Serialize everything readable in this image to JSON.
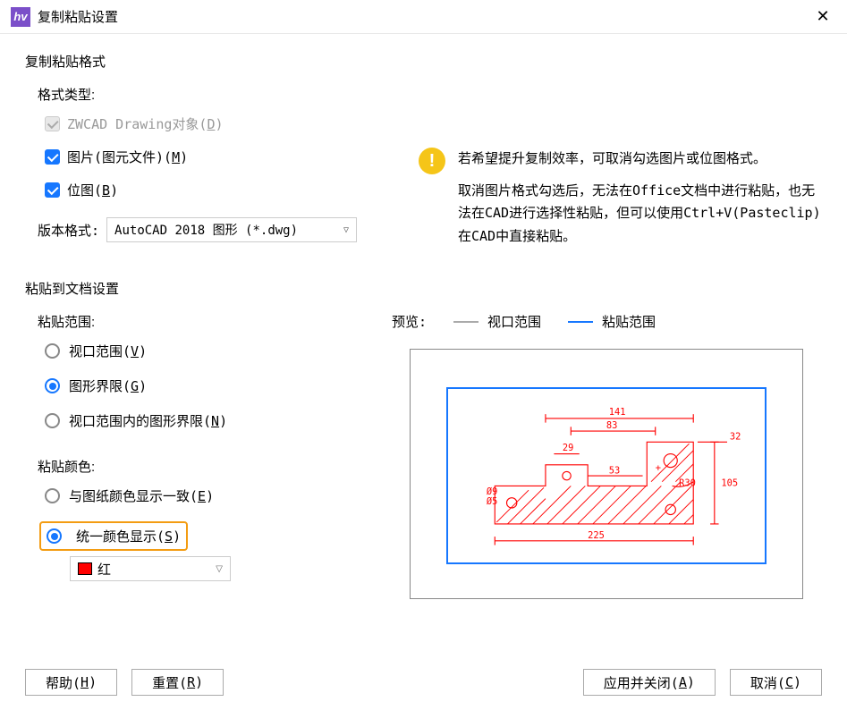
{
  "titlebar": {
    "app_icon": "hv",
    "title": "复制粘贴设置"
  },
  "section_format": {
    "title": "复制粘贴格式",
    "type_label": "格式类型:",
    "cb_zwcad": "ZWCAD Drawing对象(D)",
    "cb_metafile": "图片(图元文件)(M)",
    "cb_bitmap": "位图(B)",
    "version_label": "版本格式:",
    "version_value": "AutoCAD 2018 图形 (*.dwg)"
  },
  "info": {
    "line1": "若希望提升复制效率，可取消勾选图片或位图格式。",
    "line2": "取消图片格式勾选后，无法在Office文档中进行粘贴，也无法在CAD进行选择性粘贴，但可以使用Ctrl+V(Pasteclip)在CAD中直接粘贴。"
  },
  "section_paste": {
    "title": "粘贴到文档设置",
    "range_label": "粘贴范围:",
    "r_viewport": "视口范围(V)",
    "r_limits": "图形界限(G)",
    "r_combined": "视口范围内的图形界限(N)",
    "color_label": "粘贴颜色:",
    "r_same_as_drawing": "与图纸颜色显示一致(E)",
    "r_unified": "统一颜色显示(S)",
    "color_value": "红"
  },
  "preview": {
    "label": "预览:",
    "legend_viewport": "视口范围",
    "legend_paste": "粘贴范围",
    "dims": {
      "d141": "141",
      "d83": "83",
      "d32": "32",
      "d29": "29",
      "d53": "53",
      "d105": "105",
      "r30": "R30",
      "d225": "225",
      "phi9": "Ø9",
      "phi5": "Ø5"
    }
  },
  "footer": {
    "help": "帮助(H)",
    "reset": "重置(R)",
    "apply_close": "应用并关闭(A)",
    "cancel": "取消(C)"
  }
}
